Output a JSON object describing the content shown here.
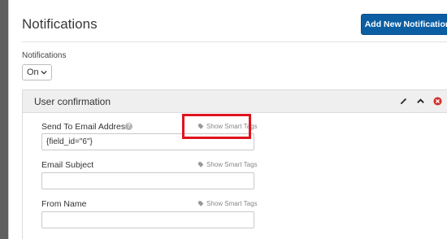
{
  "header": {
    "title": "Notifications",
    "add_button_label": "Add New Notification"
  },
  "notifications_toggle": {
    "label": "Notifications",
    "value": "On"
  },
  "notification_card": {
    "title": "User confirmation",
    "fields": {
      "send_to": {
        "label": "Send To Email Address",
        "value": "{field_id=\"6\"}",
        "smart_tags": "Show Smart Tags"
      },
      "subject": {
        "label": "Email Subject",
        "value": "",
        "smart_tags": "Show Smart Tags"
      },
      "from_name": {
        "label": "From Name",
        "value": "",
        "smart_tags": "Show Smart Tags"
      }
    }
  },
  "colors": {
    "primary_button": "#0c5ea3",
    "highlight_box": "#e0141e",
    "delete_icon": "#d0312d",
    "backdrop": "#5f5f5f"
  },
  "icons": [
    "chevron-down-icon",
    "pencil-icon",
    "chevron-up-icon",
    "delete-icon",
    "help-icon",
    "tag-icon"
  ]
}
